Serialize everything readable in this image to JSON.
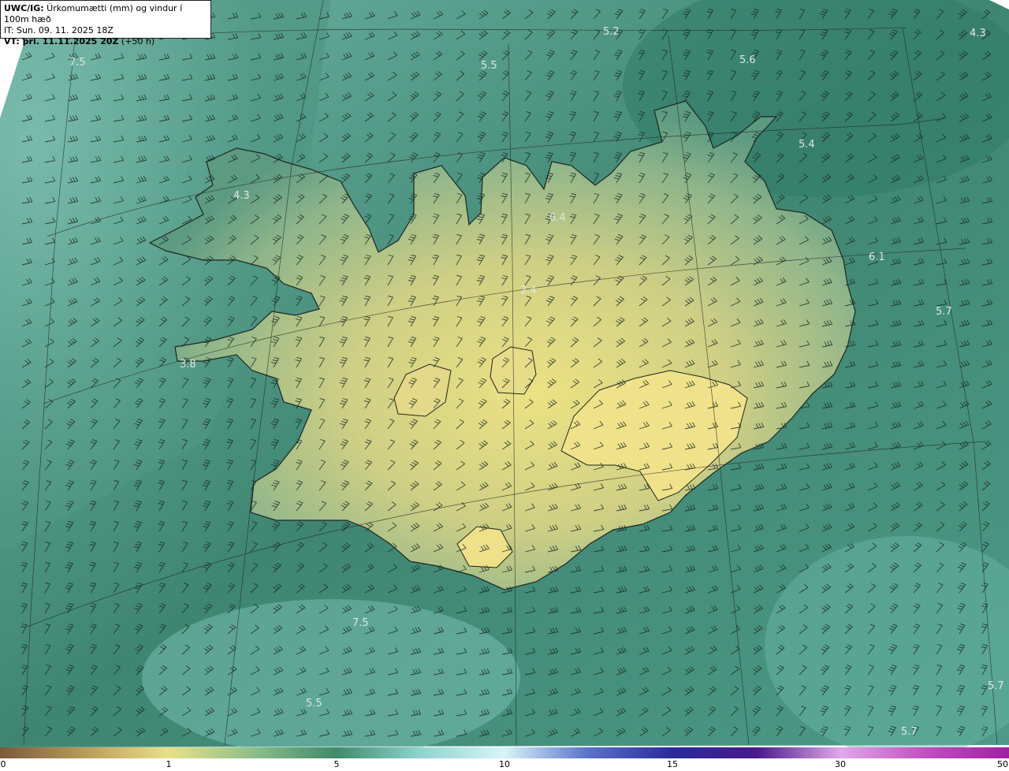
{
  "header": {
    "model": "UWC/IG:",
    "title": " Úrkomumætti (mm) og vindur í 100m hæð",
    "issue_time": "IT: Sun. 09. 11. 2025 18Z",
    "valid_prefix": "VT:",
    "valid_time": " þri. 11.11.2025 20Z",
    "valid_offset": " (+50 h)"
  },
  "colors": {
    "background": "#ffffff",
    "ocean": "#4c9483",
    "land_high": "#e6df8a",
    "coast": "#1e2520",
    "wind_barb": "#1a2a24"
  },
  "map_labels": [
    "5.2",
    "4.3",
    "7.5",
    "5.5",
    "5.6",
    "5.4",
    "4.3",
    "6.4",
    "6.1",
    "5.7",
    "2.4",
    "3.8",
    "7.5",
    "5.5",
    "5.7",
    "5.7"
  ],
  "legend": {
    "ticks": [
      "0",
      "1",
      "5",
      "10",
      "15",
      "30",
      "50"
    ],
    "colors": [
      "#7a5a3c",
      "#b89a5a",
      "#e8e08a",
      "#8fbf8a",
      "#3f8a6a",
      "#8fd4d0",
      "#d8f4f8",
      "#5a72c8",
      "#2a2a9a",
      "#4a1a8a",
      "#e0a8e8",
      "#c050c0",
      "#a020a0"
    ]
  }
}
